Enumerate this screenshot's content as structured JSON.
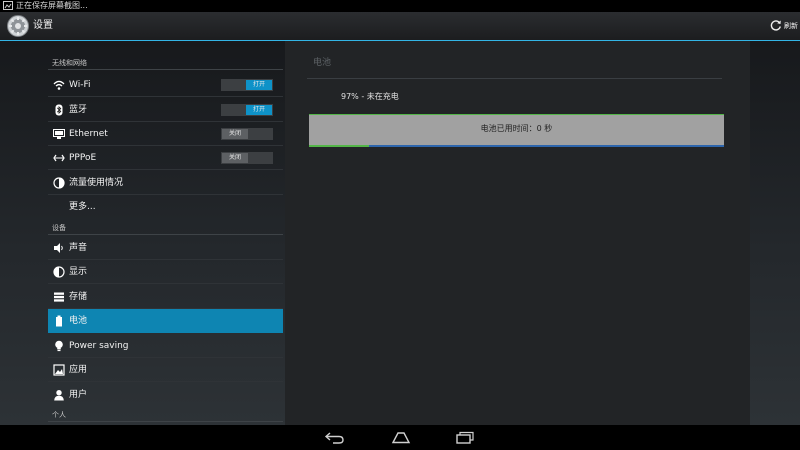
{
  "status_bar": {
    "notification": "正在保存屏幕截图..."
  },
  "action_bar": {
    "title": "设置",
    "refresh_label": "刷新"
  },
  "sections": [
    {
      "header": "无线和网络",
      "items": [
        {
          "label": "Wi-Fi",
          "icon": "wifi-icon",
          "toggle": "打开",
          "toggle_state": "on"
        },
        {
          "label": "蓝牙",
          "icon": "bluetooth-icon",
          "toggle": "打开",
          "toggle_state": "on"
        },
        {
          "label": "Ethernet",
          "icon": "ethernet-icon",
          "toggle": "关闭",
          "toggle_state": "off"
        },
        {
          "label": "PPPoE",
          "icon": "pppoe-icon",
          "toggle": "关闭",
          "toggle_state": "off"
        },
        {
          "label": "流量使用情况",
          "icon": "data-usage-icon"
        },
        {
          "label": "更多..."
        }
      ]
    },
    {
      "header": "设备",
      "items": [
        {
          "label": "声音",
          "icon": "speaker-icon"
        },
        {
          "label": "显示",
          "icon": "display-icon"
        },
        {
          "label": "存储",
          "icon": "storage-icon"
        },
        {
          "label": "电池",
          "icon": "battery-icon",
          "selected": true
        },
        {
          "label": "Power saving",
          "icon": "lightbulb-icon"
        },
        {
          "label": "应用",
          "icon": "apps-icon"
        },
        {
          "label": "用户",
          "icon": "user-icon"
        }
      ]
    },
    {
      "header": "个人"
    }
  ],
  "battery": {
    "title": "电池",
    "status": "97% - 未在充电",
    "usage_time": "电池已用时间：0 秒"
  },
  "colors": {
    "accent": "#33b5e5",
    "selected": "#0e85b2",
    "toggle_on": "#0e92c8",
    "bar_green": "#53b548",
    "bar_blue": "#2d65ac"
  },
  "nav_icons": [
    "back-icon",
    "home-icon",
    "recent-apps-icon"
  ]
}
